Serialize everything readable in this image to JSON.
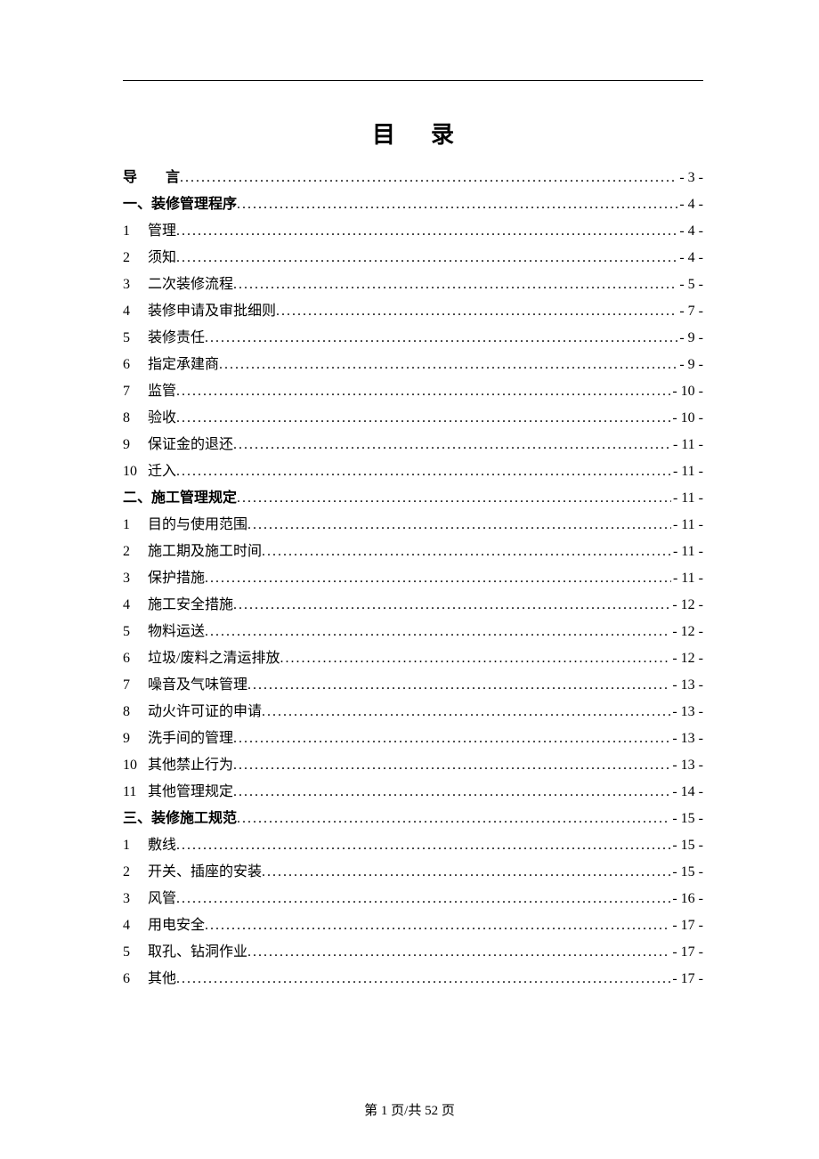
{
  "title": "目录",
  "footer": "第 1 页/共 52 页",
  "toc": [
    {
      "num": "",
      "label": "导　　言",
      "page": "- 3 -",
      "heading": true,
      "indent": false
    },
    {
      "num": "",
      "label": "一、装修管理程序",
      "page": "- 4 -",
      "heading": true,
      "indent": false
    },
    {
      "num": "1",
      "label": "管理",
      "page": "- 4 -",
      "heading": false,
      "indent": true
    },
    {
      "num": "2",
      "label": "须知",
      "page": "- 4 -",
      "heading": false,
      "indent": true
    },
    {
      "num": "3",
      "label": "二次装修流程",
      "page": "- 5 -",
      "heading": false,
      "indent": true
    },
    {
      "num": "4",
      "label": "装修申请及审批细则",
      "page": "- 7 -",
      "heading": false,
      "indent": true
    },
    {
      "num": "5",
      "label": "装修责任",
      "page": "- 9 -",
      "heading": false,
      "indent": true
    },
    {
      "num": "6",
      "label": "指定承建商",
      "page": "- 9 -",
      "heading": false,
      "indent": true
    },
    {
      "num": "7",
      "label": "监管",
      "page": "- 10 -",
      "heading": false,
      "indent": true
    },
    {
      "num": "8",
      "label": "验收",
      "page": "- 10 -",
      "heading": false,
      "indent": true
    },
    {
      "num": "9",
      "label": "保证金的退还",
      "page": "- 11 -",
      "heading": false,
      "indent": true
    },
    {
      "num": "10",
      "label": "迁入",
      "page": "- 11 -",
      "heading": false,
      "indent": true
    },
    {
      "num": "",
      "label": "二、施工管理规定",
      "page": "- 11 -",
      "heading": true,
      "indent": false
    },
    {
      "num": "1",
      "label": "目的与使用范围",
      "page": "- 11 -",
      "heading": false,
      "indent": true
    },
    {
      "num": "2",
      "label": "施工期及施工时间",
      "page": "- 11 -",
      "heading": false,
      "indent": true
    },
    {
      "num": "3",
      "label": "保护措施",
      "page": "- 11 -",
      "heading": false,
      "indent": true
    },
    {
      "num": "4",
      "label": "施工安全措施",
      "page": "- 12 -",
      "heading": false,
      "indent": true
    },
    {
      "num": "5",
      "label": "物料运送",
      "page": "- 12 -",
      "heading": false,
      "indent": true
    },
    {
      "num": "6",
      "label": "垃圾/废料之清运排放",
      "page": "- 12 -",
      "heading": false,
      "indent": true
    },
    {
      "num": "7",
      "label": "噪音及气味管理",
      "page": "- 13 -",
      "heading": false,
      "indent": true
    },
    {
      "num": "8",
      "label": "动火许可证的申请",
      "page": "- 13 -",
      "heading": false,
      "indent": true
    },
    {
      "num": "9",
      "label": "洗手间的管理",
      "page": "- 13 -",
      "heading": false,
      "indent": true
    },
    {
      "num": "10",
      "label": "其他禁止行为",
      "page": "- 13 -",
      "heading": false,
      "indent": true
    },
    {
      "num": "11",
      "label": "其他管理规定",
      "page": "- 14 -",
      "heading": false,
      "indent": true
    },
    {
      "num": "",
      "label": "三、装修施工规范",
      "page": "- 15 -",
      "heading": true,
      "indent": false
    },
    {
      "num": "1",
      "label": "敷线",
      "page": "- 15 -",
      "heading": false,
      "indent": true
    },
    {
      "num": "2",
      "label": "开关、插座的安装",
      "page": "- 15 -",
      "heading": false,
      "indent": true
    },
    {
      "num": "3",
      "label": "风管",
      "page": "- 16 -",
      "heading": false,
      "indent": true
    },
    {
      "num": "4",
      "label": "用电安全",
      "page": "- 17 -",
      "heading": false,
      "indent": true
    },
    {
      "num": "5",
      "label": "取孔、钻洞作业",
      "page": "- 17 -",
      "heading": false,
      "indent": true
    },
    {
      "num": "6",
      "label": "其他",
      "page": "- 17 -",
      "heading": false,
      "indent": true
    }
  ]
}
